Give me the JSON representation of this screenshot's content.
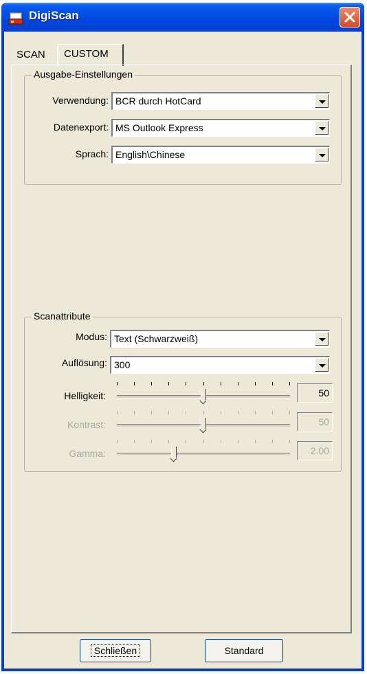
{
  "window": {
    "title": "DigiScan"
  },
  "tabs": [
    {
      "label": "SCAN",
      "active": false
    },
    {
      "label": "CUSTOM",
      "active": true
    }
  ],
  "output_group": {
    "title": "Ausgabe-Einstellungen",
    "rows": [
      {
        "label": "Verwendung:",
        "value": "BCR durch HotCard"
      },
      {
        "label": "Datenexport:",
        "value": "MS Outlook Express"
      },
      {
        "label": "Sprach:",
        "value": "English\\Chinese"
      }
    ]
  },
  "scan_group": {
    "title": "Scanattribute",
    "mode": {
      "label": "Modus:",
      "value": "Text (Schwarzweiß)"
    },
    "resolution": {
      "label": "Auflösung:",
      "value": "300"
    },
    "brightness": {
      "label": "Helligkeit:",
      "value": "50",
      "level": 0.5,
      "enabled": true
    },
    "contrast": {
      "label": "Kontrast:",
      "value": "50",
      "level": 0.5,
      "enabled": false
    },
    "gamma": {
      "label": "Gamma:",
      "value": "2.00",
      "level": 0.33,
      "enabled": false
    }
  },
  "buttons": {
    "close": "Schließen",
    "standard": "Standard"
  },
  "colors": {
    "titlebar": "#0048e0",
    "face": "#ece9d8",
    "close": "#d84a24"
  },
  "icons": {
    "app": "app-icon",
    "close": "close-icon"
  }
}
